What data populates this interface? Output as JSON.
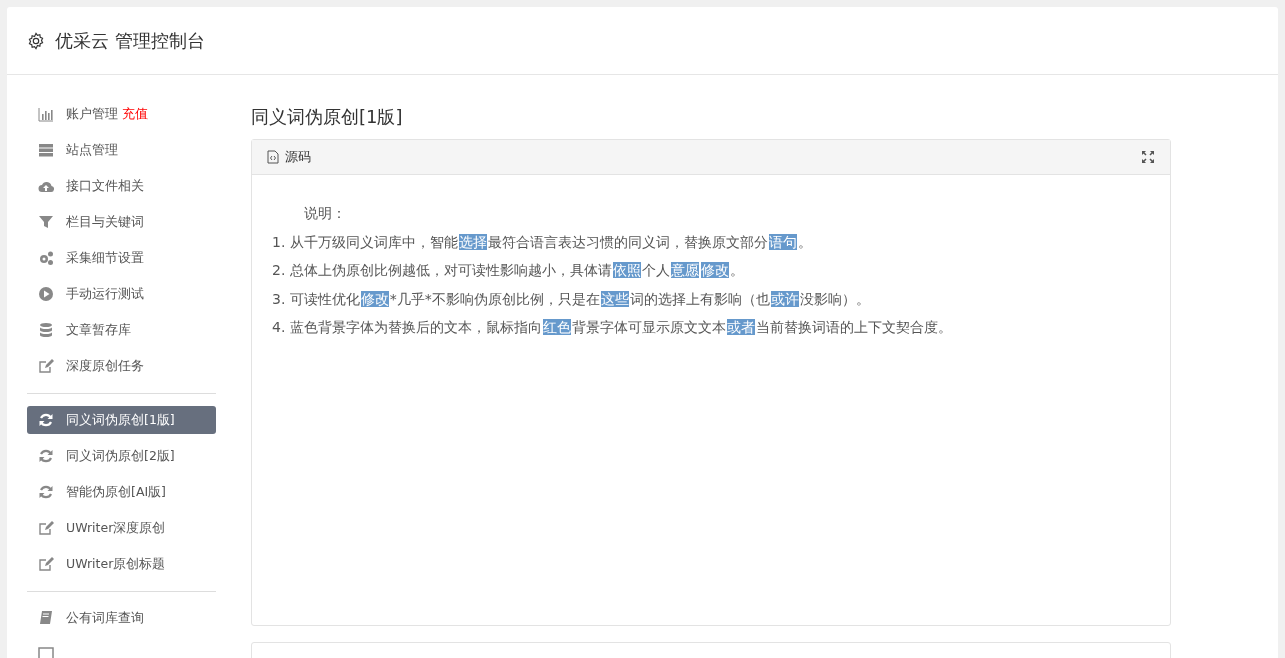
{
  "header": {
    "title": "优采云 管理控制台"
  },
  "sidebar": {
    "groups": [
      {
        "items": [
          {
            "label": "账户管理",
            "badge": "充值",
            "selected": false
          },
          {
            "label": "站点管理",
            "selected": false
          },
          {
            "label": "接口文件相关",
            "selected": false
          },
          {
            "label": "栏目与关键词",
            "selected": false
          },
          {
            "label": "采集细节设置",
            "selected": false
          },
          {
            "label": "手动运行测试",
            "selected": false
          },
          {
            "label": "文章暂存库",
            "selected": false
          },
          {
            "label": "深度原创任务",
            "selected": false
          }
        ]
      },
      {
        "items": [
          {
            "label": "同义词伪原创[1版]",
            "selected": true
          },
          {
            "label": "同义词伪原创[2版]",
            "selected": false
          },
          {
            "label": "智能伪原创[AI版]",
            "selected": false
          },
          {
            "label": "UWriter深度原创",
            "selected": false
          },
          {
            "label": "UWriter原创标题",
            "selected": false
          }
        ]
      },
      {
        "items": [
          {
            "label": "公有词库查询",
            "selected": false
          },
          {
            "selected": false
          }
        ]
      }
    ]
  },
  "content": {
    "title": "同义词伪原创[1版]",
    "panel": {
      "title": "源码",
      "intro": "说明：",
      "lines": [
        [
          {
            "text": "1. 从千万级同义词库中，智能",
            "highlight": false
          },
          {
            "text": "选择",
            "highlight": true
          },
          {
            "text": "最符合语言表达习惯的同义词，替换原文部分",
            "highlight": false
          },
          {
            "text": "语句",
            "highlight": true
          },
          {
            "text": "。",
            "highlight": false
          }
        ],
        [
          {
            "text": "2. 总体上伪原创比例越低，对可读性影响越小，具体请",
            "highlight": false
          },
          {
            "text": "依照",
            "highlight": true
          },
          {
            "text": "个人",
            "highlight": false
          },
          {
            "text": "意愿",
            "highlight": true
          },
          {
            "text": "修改",
            "highlight": true
          },
          {
            "text": "。",
            "highlight": false
          }
        ],
        [
          {
            "text": "3. 可读性优化",
            "highlight": false
          },
          {
            "text": "修改",
            "highlight": true
          },
          {
            "text": "*几乎*不影响伪原创比例，只是在",
            "highlight": false
          },
          {
            "text": "这些",
            "highlight": true
          },
          {
            "text": "词的选择上有影响（也",
            "highlight": false
          },
          {
            "text": "或许",
            "highlight": true
          },
          {
            "text": "没影响）。",
            "highlight": false
          }
        ],
        [
          {
            "text": "4. 蓝色背景字体为替换后的文本，鼠标指向",
            "highlight": false
          },
          {
            "text": "红色",
            "highlight": true
          },
          {
            "text": "背景字体可显示原文文本",
            "highlight": false
          },
          {
            "text": "或者",
            "highlight": true
          },
          {
            "text": "当前替换词语的上下文契合度。",
            "highlight": false
          }
        ]
      ]
    }
  }
}
